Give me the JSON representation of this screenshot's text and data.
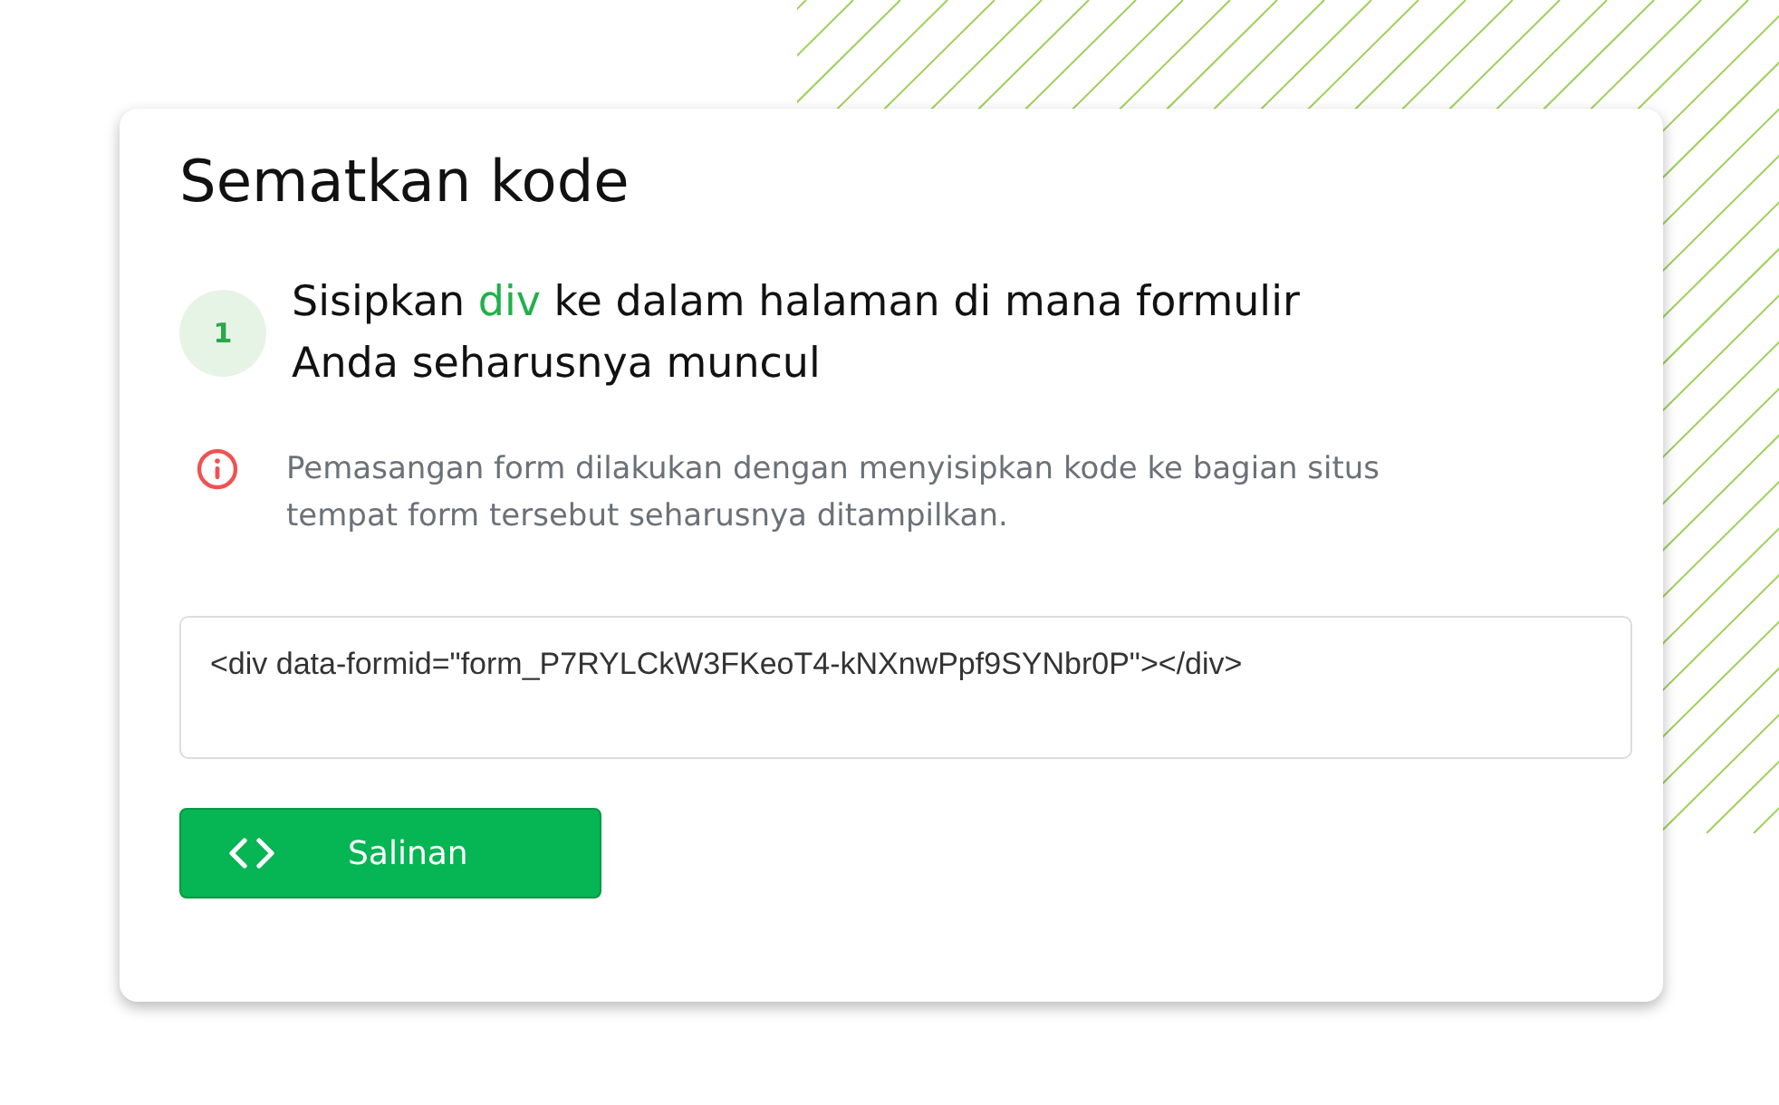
{
  "title": "Sematkan kode",
  "step": {
    "number": "1",
    "before": "Sisipkan ",
    "highlight": "div",
    "after": " ke dalam halaman di mana formulir Anda seharusnya muncul"
  },
  "info": "Pemasangan form dilakukan dengan menyisipkan kode ke bagian situs tempat form tersebut seharusnya ditampilkan.",
  "code": "<div data-formid=\"form_P7RYLCkW3FKeoT4-kNXnwPpf9SYNbr0P\"></div>",
  "copy_button": {
    "label": "Salinan"
  }
}
